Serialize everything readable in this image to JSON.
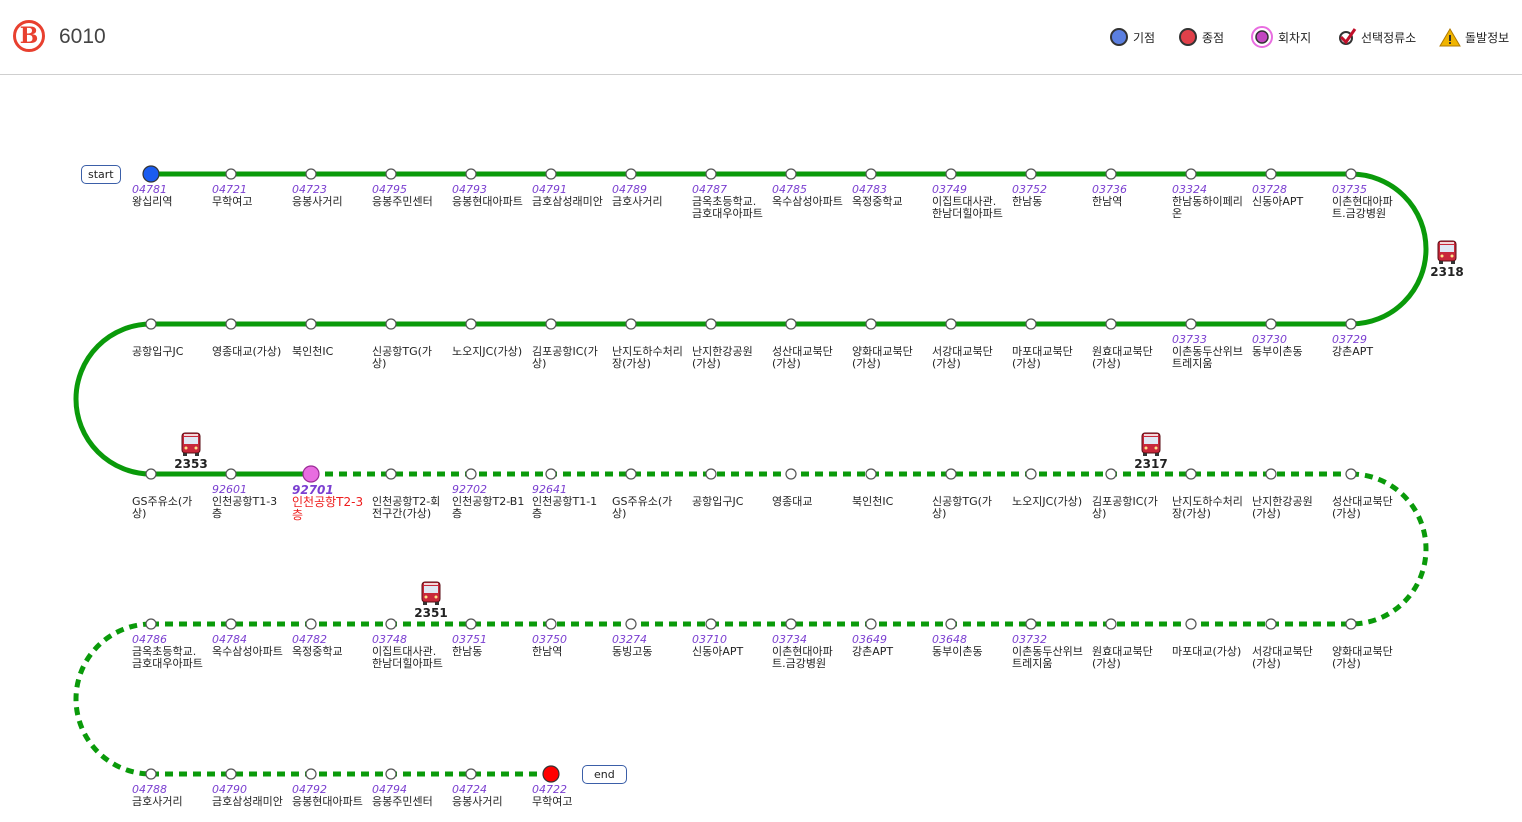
{
  "header": {
    "logo_letter": "B",
    "route_number": "6010"
  },
  "legend": [
    {
      "label": "기점",
      "icon": "start-dot-icon",
      "color": "#5b7fe0"
    },
    {
      "label": "종점",
      "icon": "end-dot-icon",
      "color": "#e0404a"
    },
    {
      "label": "회차지",
      "icon": "turnaround-dot-icon",
      "color": "#e86de0"
    },
    {
      "label": "선택정류소",
      "icon": "checkmark-icon",
      "color": "#c0102a"
    },
    {
      "label": "돌발정보",
      "icon": "warning-icon",
      "color": "#f0b400"
    }
  ],
  "tags": {
    "start": "start",
    "end": "end"
  },
  "colors": {
    "line": "#0a9a0a",
    "start": "#1a5cf0",
    "end": "#ff0000",
    "turn": "#e86de0"
  },
  "rows": [
    {
      "stops": [
        {
          "no": "04781",
          "name": "왕십리역",
          "type": "start"
        },
        {
          "no": "04721",
          "name": "무학여고"
        },
        {
          "no": "04723",
          "name": "응봉사거리"
        },
        {
          "no": "04795",
          "name": "응봉주민센터"
        },
        {
          "no": "04793",
          "name": "응봉현대아파트"
        },
        {
          "no": "04791",
          "name": "금호삼성래미안"
        },
        {
          "no": "04789",
          "name": "금호사거리"
        },
        {
          "no": "04787",
          "name": "금옥초등학교.금호대우아파트"
        },
        {
          "no": "04785",
          "name": "옥수삼성아파트"
        },
        {
          "no": "04783",
          "name": "옥정중학교"
        },
        {
          "no": "03749",
          "name": "이집트대사관.한남더힐아파트"
        },
        {
          "no": "03752",
          "name": "한남동"
        },
        {
          "no": "03736",
          "name": "한남역"
        },
        {
          "no": "03324",
          "name": "한남동하이페리온"
        },
        {
          "no": "03728",
          "name": "신동아APT"
        },
        {
          "no": "03735",
          "name": "이촌현대아파트.금강병원"
        }
      ]
    },
    {
      "stops": [
        {
          "no": "",
          "name": "공항입구JC"
        },
        {
          "no": "",
          "name": "영종대교(가상)"
        },
        {
          "no": "",
          "name": "북인천IC"
        },
        {
          "no": "",
          "name": "신공항TG(가상)"
        },
        {
          "no": "",
          "name": "노오지JC(가상)"
        },
        {
          "no": "",
          "name": "김포공항IC(가상)"
        },
        {
          "no": "",
          "name": "난지도하수처리장(가상)"
        },
        {
          "no": "",
          "name": "난지한강공원(가상)"
        },
        {
          "no": "",
          "name": "성산대교북단(가상)"
        },
        {
          "no": "",
          "name": "양화대교북단(가상)"
        },
        {
          "no": "",
          "name": "서강대교북단(가상)"
        },
        {
          "no": "",
          "name": "마포대교북단(가상)"
        },
        {
          "no": "",
          "name": "원효대교북단(가상)"
        },
        {
          "no": "03733",
          "name": "이촌동두산위브트레지움"
        },
        {
          "no": "03730",
          "name": "동부이촌동"
        },
        {
          "no": "03729",
          "name": "강촌APT"
        }
      ]
    },
    {
      "stops": [
        {
          "no": "",
          "name": "GS주유소(가상)"
        },
        {
          "no": "92601",
          "name": "인천공항T1-3층"
        },
        {
          "no": "92701",
          "name": "인천공항T2-3층",
          "type": "turn"
        },
        {
          "no": "",
          "name": "인천공항T2-회전구간(가상)"
        },
        {
          "no": "92702",
          "name": "인천공항T2-B1층"
        },
        {
          "no": "92641",
          "name": "인천공항T1-1층"
        },
        {
          "no": "",
          "name": "GS주유소(가상)"
        },
        {
          "no": "",
          "name": "공항입구JC"
        },
        {
          "no": "",
          "name": "영종대교"
        },
        {
          "no": "",
          "name": "북인천IC"
        },
        {
          "no": "",
          "name": "신공항TG(가상)"
        },
        {
          "no": "",
          "name": "노오지JC(가상)"
        },
        {
          "no": "",
          "name": "김포공항IC(가상)"
        },
        {
          "no": "",
          "name": "난지도하수처리장(가상)"
        },
        {
          "no": "",
          "name": "난지한강공원(가상)"
        },
        {
          "no": "",
          "name": "성산대교북단(가상)"
        }
      ]
    },
    {
      "stops": [
        {
          "no": "04786",
          "name": "금옥초등학교.금호대우아파트"
        },
        {
          "no": "04784",
          "name": "옥수삼성아파트"
        },
        {
          "no": "04782",
          "name": "옥정중학교"
        },
        {
          "no": "03748",
          "name": "이집트대사관.한남더힐아파트"
        },
        {
          "no": "03751",
          "name": "한남동"
        },
        {
          "no": "03750",
          "name": "한남역"
        },
        {
          "no": "03274",
          "name": "동빙고동"
        },
        {
          "no": "03710",
          "name": "신동아APT"
        },
        {
          "no": "03734",
          "name": "이촌현대아파트.금강병원"
        },
        {
          "no": "03649",
          "name": "강촌APT"
        },
        {
          "no": "03648",
          "name": "동부이촌동"
        },
        {
          "no": "03732",
          "name": "이촌동두산위브트레지움"
        },
        {
          "no": "",
          "name": "원효대교북단(가상)"
        },
        {
          "no": "",
          "name": "마포대교(가상)"
        },
        {
          "no": "",
          "name": "서강대교북단(가상)"
        },
        {
          "no": "",
          "name": "양화대교북단(가상)"
        }
      ]
    },
    {
      "stops": [
        {
          "no": "04788",
          "name": "금호사거리"
        },
        {
          "no": "04790",
          "name": "금호삼성래미안"
        },
        {
          "no": "04792",
          "name": "응봉현대아파트"
        },
        {
          "no": "04794",
          "name": "응봉주민센터"
        },
        {
          "no": "04724",
          "name": "응봉사거리"
        },
        {
          "no": "04722",
          "name": "무학여고",
          "type": "end"
        }
      ]
    }
  ],
  "buses": [
    {
      "number": "2318"
    },
    {
      "number": "2353"
    },
    {
      "number": "2317"
    },
    {
      "number": "2351"
    }
  ]
}
